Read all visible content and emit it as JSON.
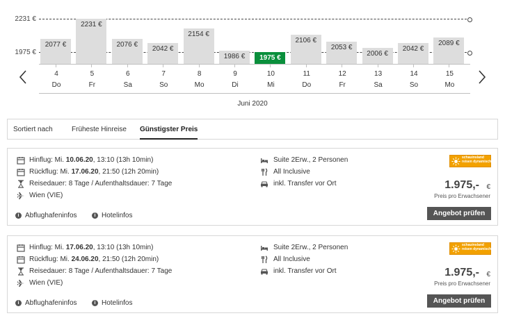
{
  "chart_data": {
    "type": "bar",
    "x_axis_label": "Juni 2020",
    "reference_lines": [
      "2231 €",
      "1975 €"
    ],
    "reference_values": [
      2231,
      1975
    ],
    "categories": [
      "4",
      "5",
      "6",
      "7",
      "8",
      "9",
      "10",
      "11",
      "12",
      "13",
      "14",
      "15"
    ],
    "weekdays": [
      "Do",
      "Fr",
      "Sa",
      "So",
      "Mo",
      "Di",
      "Mi",
      "Do",
      "Fr",
      "Sa",
      "So",
      "Mo"
    ],
    "values": [
      2077,
      2231,
      2076,
      2042,
      2154,
      1986,
      1975,
      2106,
      2053,
      2006,
      2042,
      2089
    ],
    "labels": [
      "2077 €",
      "2231 €",
      "2076 €",
      "2042 €",
      "2154 €",
      "1986 €",
      "1975 €",
      "2106 €",
      "2053 €",
      "2006 €",
      "2042 €",
      "2089 €"
    ],
    "selected_index": 6,
    "colors": {
      "bar": "#dddddd",
      "selected": "#0a8f3c"
    }
  },
  "nav": {
    "prev_icon": "chevron-left-icon",
    "next_icon": "chevron-right-icon"
  },
  "sort": {
    "label": "Sortiert nach",
    "options": [
      {
        "label": "Früheste Hinreise",
        "active": false
      },
      {
        "label": "Günstigster Preis",
        "active": true
      }
    ]
  },
  "offers": [
    {
      "outbound_prefix": "Hinflug: Mi. ",
      "outbound_date": "10.06.20",
      "outbound_suffix": ", 13:10 (13h 10min)",
      "return_prefix": "Rückflug: Mi. ",
      "return_date": "17.06.20",
      "return_suffix": ", 21:50 (12h 20min)",
      "duration": "Reisedauer: 8 Tage / Aufenthaltsdauer: 7 Tage",
      "airport": "Wien (VIE)",
      "room": "Suite 2Erw., 2 Personen",
      "board": "All Inclusive",
      "transfer": "inkl. Transfer vor Ort",
      "airport_info": "Abflughafeninfos",
      "hotel_info": "Hotelinfos",
      "operator_logo_line1": "schauinsland",
      "operator_logo_line2": "reisen dynamisch",
      "price": "1.975,-",
      "currency": "€",
      "price_note": "Preis pro Erwachsener",
      "cta": "Angebot prüfen"
    },
    {
      "outbound_prefix": "Hinflug: Mi. ",
      "outbound_date": "17.06.20",
      "outbound_suffix": ", 13:10 (13h 10min)",
      "return_prefix": "Rückflug: Mi. ",
      "return_date": "24.06.20",
      "return_suffix": ", 21:50 (12h 20min)",
      "duration": "Reisedauer: 8 Tage / Aufenthaltsdauer: 7 Tage",
      "airport": "Wien (VIE)",
      "room": "Suite 2Erw., 2 Personen",
      "board": "All Inclusive",
      "transfer": "inkl. Transfer vor Ort",
      "airport_info": "Abflughafeninfos",
      "hotel_info": "Hotelinfos",
      "operator_logo_line1": "schauinsland",
      "operator_logo_line2": "reisen dynamisch",
      "price": "1.975,-",
      "currency": "€",
      "price_note": "Preis pro Erwachsener",
      "cta": "Angebot prüfen"
    }
  ]
}
